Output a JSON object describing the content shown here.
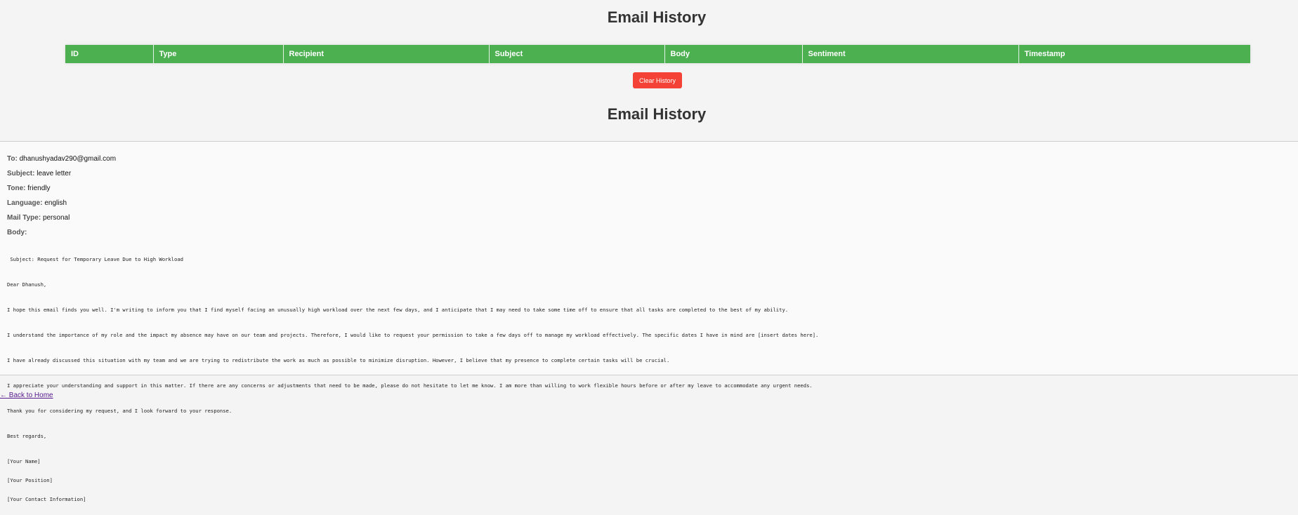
{
  "page": {
    "title": "Email History",
    "second_title": "Email History"
  },
  "table": {
    "headers": [
      "ID",
      "Type",
      "Recipient",
      "Subject",
      "Body",
      "Sentiment",
      "Timestamp"
    ]
  },
  "clear_button": {
    "label": "Clear History"
  },
  "email": {
    "to_label": "To:",
    "to": "dhanushyadav290@gmail.com",
    "subject_label": "Subject:",
    "subject": "leave letter",
    "tone_label": "Tone:",
    "tone": "friendly",
    "language_label": "Language:",
    "language": "english",
    "mail_type_label": "Mail Type:",
    "mail_type": "personal",
    "body_label": "Body:",
    "body": {
      "subject_line": " Subject: Request for Temporary Leave Due to High Workload",
      "greeting": "Dear Dhanush,",
      "p1": "I hope this email finds you well. I'm writing to inform you that I find myself facing an unusually high workload over the next few days, and I anticipate that I may need to take some time off to ensure that all tasks are completed to the best of my ability.",
      "p2": "I understand the importance of my role and the impact my absence may have on our team and projects. Therefore, I would like to request your permission to take a few days off to manage my workload effectively. The specific dates I have in mind are [insert dates here].",
      "p3": "I have already discussed this situation with my team and we are trying to redistribute the work as much as possible to minimize disruption. However, I believe that my presence to complete certain tasks will be crucial.",
      "p4": "I appreciate your understanding and support in this matter. If there are any concerns or adjustments that need to be made, please do not hesitate to let me know. I am more than willing to work flexible hours before or after my leave to accommodate any urgent needs.",
      "p5": "Thank you for considering my request, and I look forward to your response.",
      "closing": "Best regards,",
      "sig1": "[Your Name]",
      "sig2": "[Your Position]",
      "sig3": "[Your Contact Information]"
    }
  },
  "back_link": {
    "label": "← Back to Home"
  },
  "colors": {
    "header_green": "#4caf50",
    "clear_red": "#f44336",
    "page_bg": "#f4f4f4"
  }
}
